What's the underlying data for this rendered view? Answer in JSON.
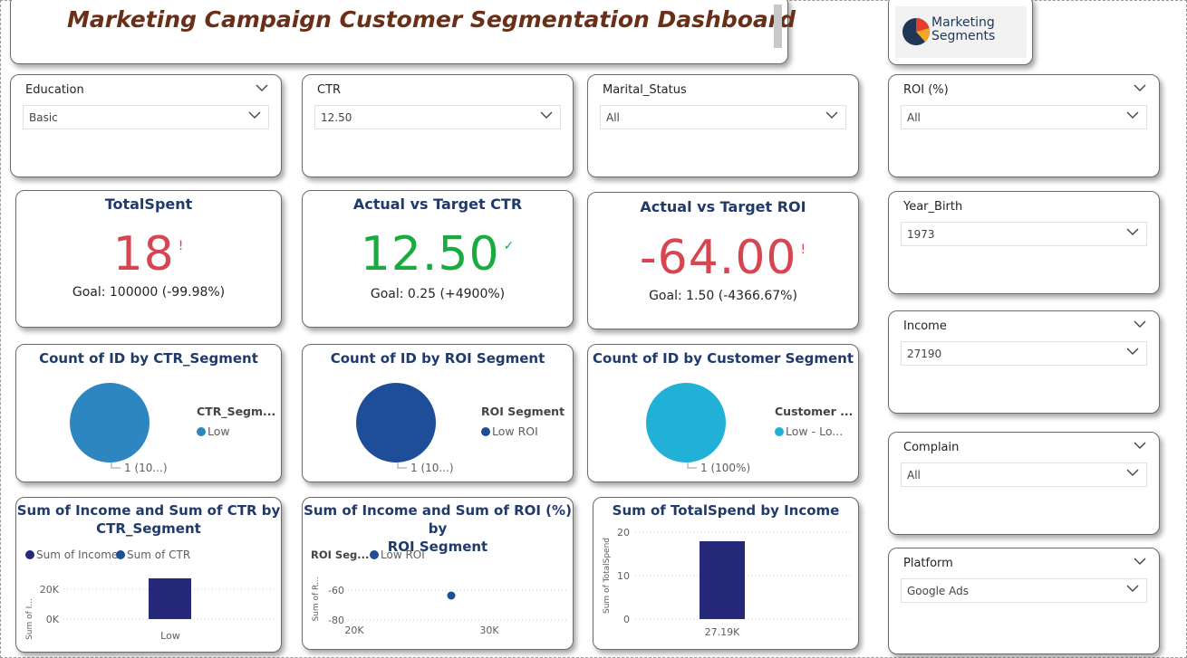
{
  "header": {
    "title": "Marketing Campaign Customer Segmentation Dashboard",
    "logo_line1": "Marketing",
    "logo_line2": "Segments",
    "logo_colors": [
      "#e63c2f",
      "#f5a524",
      "#1f3655"
    ]
  },
  "slicers": {
    "education": {
      "label": "Education",
      "value": "Basic"
    },
    "ctr": {
      "label": "CTR",
      "value": "12.50"
    },
    "marital_status": {
      "label": "Marital_Status",
      "value": "All"
    },
    "roi": {
      "label": "ROI (%)",
      "value": "All"
    },
    "year_birth": {
      "label": "Year_Birth",
      "value": "1973"
    },
    "income": {
      "label": "Income",
      "value": "27190"
    },
    "complain": {
      "label": "Complain",
      "value": "All"
    },
    "platform": {
      "label": "Platform",
      "value": "Google Ads"
    }
  },
  "kpis": {
    "total_spent": {
      "title": "TotalSpent",
      "value": "18",
      "mark": "!",
      "goal": "Goal: 100000 (-99.98%)",
      "color": "#d64550"
    },
    "ctr": {
      "title": "Actual vs Target CTR",
      "value": "12.50",
      "mark": "✓",
      "goal": "Goal: 0.25 (+4900%)",
      "color": "#1aab40"
    },
    "roi": {
      "title": "Actual vs Target ROI",
      "value": "-64.00",
      "mark": "!",
      "goal": "Goal: 1.50 (-4366.67%)",
      "color": "#d64550"
    }
  },
  "pies": {
    "ctr_segment": {
      "title": "Count of ID by CTR_Segment",
      "legend_title": "CTR_Segm...",
      "legend_item": "Low",
      "label": "1 (10...)",
      "color": "#2e86c1"
    },
    "roi_segment": {
      "title": "Count of ID by ROI Segment",
      "legend_title": "ROI Segment",
      "legend_item": "Low ROI",
      "label": "1 (10...)",
      "color": "#1f4e99"
    },
    "customer_segment": {
      "title": "Count of ID by Customer Segment",
      "legend_title": "Customer ...",
      "legend_item": "Low - Lo...",
      "label": "1 (100%)",
      "color": "#21b0d6"
    }
  },
  "bottom": {
    "income_ctr": {
      "title_line1": "Sum of Income and Sum of CTR by",
      "title_line2": "CTR_Segment",
      "legend1": "Sum of Income",
      "legend2": "Sum of CTR",
      "ylabel": "Sum of I...",
      "ticks": [
        "20K",
        "0K"
      ],
      "category": "Low"
    },
    "income_roi": {
      "title_line1": "Sum of Income and Sum of ROI (%) by",
      "title_line2": "ROI Segment",
      "legend_title": "ROI Seg...",
      "legend1": "Low ROI",
      "ylabel": "Sum of R...",
      "yticks": [
        "-60",
        "-80"
      ],
      "xticks": [
        "20K",
        "30K"
      ]
    },
    "spend_income": {
      "title": "Sum of TotalSpend by Income",
      "ylabel": "Sum of TotalSpend",
      "yticks": [
        "20",
        "10",
        "0"
      ],
      "category": "27.19K"
    }
  },
  "chart_data": [
    {
      "type": "pie",
      "title": "Count of ID by CTR_Segment",
      "categories": [
        "Low"
      ],
      "values": [
        1
      ],
      "label": "1 (10...)"
    },
    {
      "type": "pie",
      "title": "Count of ID by ROI Segment",
      "categories": [
        "Low ROI"
      ],
      "values": [
        1
      ],
      "label": "1 (10...)"
    },
    {
      "type": "pie",
      "title": "Count of ID by Customer Segment",
      "categories": [
        "Low - Lo..."
      ],
      "values": [
        1
      ],
      "label": "1 (100%)"
    },
    {
      "type": "bar",
      "title": "Sum of Income and Sum of CTR by CTR_Segment",
      "categories": [
        "Low"
      ],
      "series": [
        {
          "name": "Sum of Income",
          "values": [
            27190
          ]
        },
        {
          "name": "Sum of CTR",
          "values": [
            12.5
          ]
        }
      ],
      "ylim": [
        0,
        35000
      ]
    },
    {
      "type": "scatter",
      "title": "Sum of Income and Sum of ROI (%) by ROI Segment",
      "series": [
        {
          "name": "Low ROI",
          "x": [
            27190
          ],
          "y": [
            -64
          ]
        }
      ],
      "xlim": [
        20000,
        30000
      ],
      "ylim": [
        -80,
        -50
      ]
    },
    {
      "type": "bar",
      "title": "Sum of TotalSpend by Income",
      "categories": [
        "27.19K"
      ],
      "values": [
        18
      ],
      "ylabel": "Sum of TotalSpend",
      "ylim": [
        0,
        20
      ]
    }
  ]
}
